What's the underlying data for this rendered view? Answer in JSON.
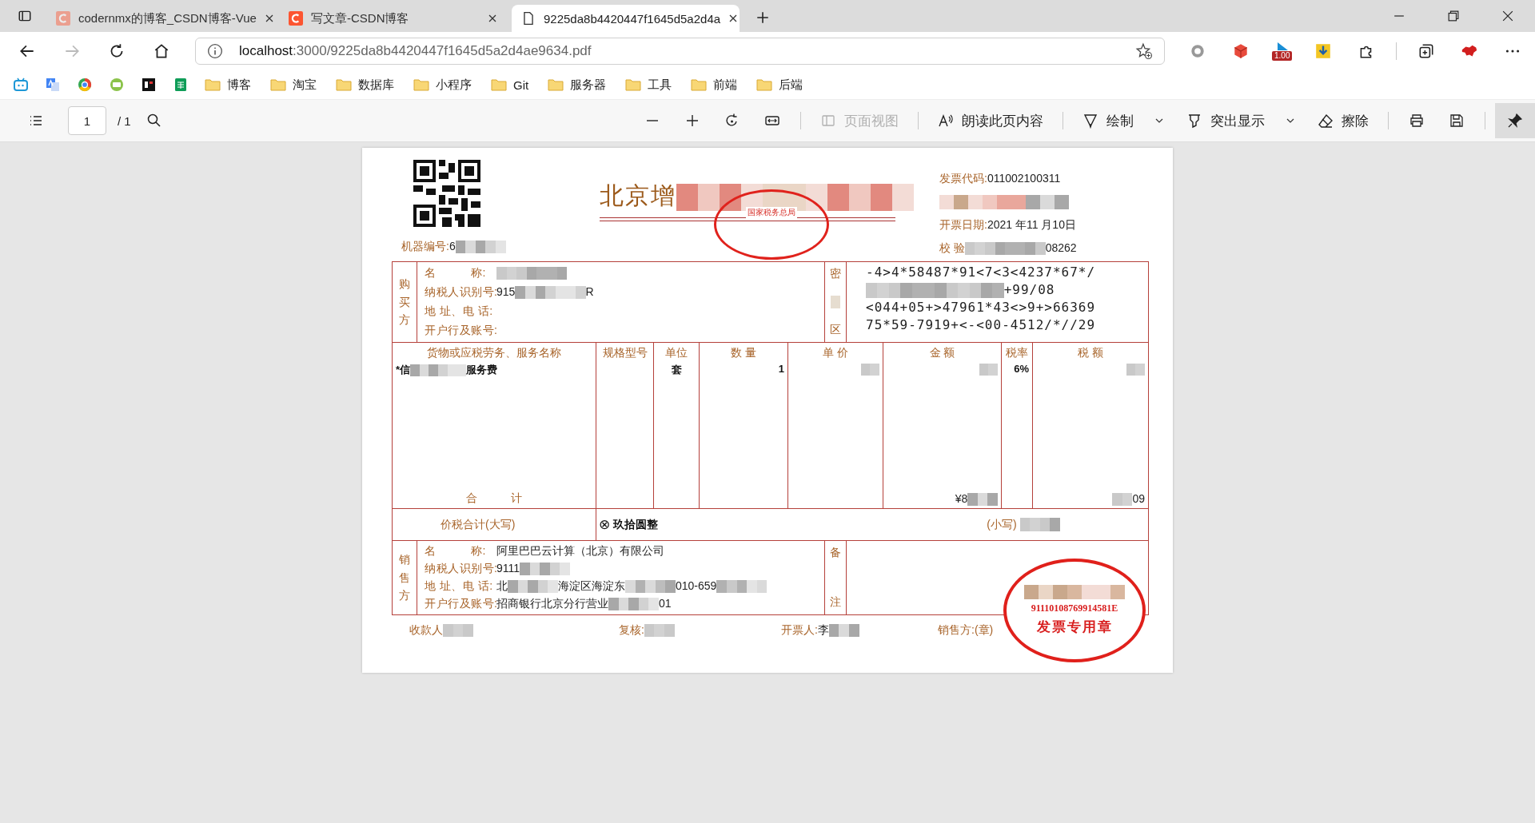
{
  "tabs": [
    {
      "title": "codernmx的博客_CSDN博客-Vue",
      "kind": "site",
      "selected": false
    },
    {
      "title": "写文章-CSDN博客",
      "kind": "site",
      "selected": false
    },
    {
      "title": "9225da8b4420447f1645d5a2d4a",
      "kind": "file",
      "selected": true
    }
  ],
  "address_bar": {
    "host": "localhost",
    "path": ":3000/9225da8b4420447f1645d5a2d4ae9634.pdf"
  },
  "extension_badge": "1.00",
  "bookmark_folders": [
    "博客",
    "淘宝",
    "数据库",
    "小程序",
    "Git",
    "服务器",
    "工具",
    "前端",
    "后端"
  ],
  "pdf_toolbar": {
    "page": "1",
    "page_total": "/ 1",
    "tools": [
      {
        "kind": "view",
        "label": "页面视图",
        "disabled": true
      },
      {
        "kind": "read",
        "label": "朗读此页内容",
        "disabled": false
      },
      {
        "kind": "draw",
        "label": "绘制",
        "disabled": false
      },
      {
        "kind": "highlight",
        "label": "突出显示",
        "disabled": false
      },
      {
        "kind": "erase",
        "label": "擦除",
        "disabled": false
      }
    ]
  },
  "invoice": {
    "title": [
      {
        "kind": "text",
        "text": "北京增"
      },
      {
        "kind": "redacted"
      }
    ],
    "stamp_text": "国家税务总局",
    "code": {
      "label": "发票代码:",
      "parts": [
        {
          "kind": "text",
          "text": "011002100311"
        }
      ]
    },
    "date": {
      "label": "开票日期:",
      "parts": [
        {
          "kind": "text",
          "text": "2021 年11 月10日"
        }
      ]
    },
    "check": {
      "label": "校 验",
      "parts": [
        {
          "kind": "redacted"
        },
        {
          "kind": "text",
          "text": "08262"
        }
      ]
    },
    "machine": {
      "label": "机器编号:",
      "parts": [
        {
          "kind": "text",
          "text": "6"
        },
        {
          "kind": "redacted"
        }
      ]
    },
    "buyer": {
      "side": "购买方",
      "fields": [
        {
          "label": "名　　　称:",
          "parts": [
            {
              "kind": "redacted"
            }
          ]
        },
        {
          "label": "纳税人识别号:",
          "parts": [
            {
              "kind": "text",
              "text": "915"
            },
            {
              "kind": "redacted"
            },
            {
              "kind": "text",
              "text": "R"
            }
          ]
        },
        {
          "label": "地 址、电 话:"
        },
        {
          "label": "开户行及账号:"
        }
      ]
    },
    "cipher_label": [
      "密",
      "区"
    ],
    "cipher_lines": [
      {
        "parts": [
          {
            "kind": "text",
            "text": "-4>4*58487*91<7<3<4237*67*/"
          }
        ]
      },
      {
        "parts": [
          {
            "kind": "redacted"
          },
          {
            "kind": "text",
            "text": "+99/08"
          }
        ]
      },
      {
        "parts": [
          {
            "kind": "text",
            "text": "<044+05+>47961*43<>9+>66369"
          }
        ]
      },
      {
        "parts": [
          {
            "kind": "text",
            "text": "75*59-7919+<-<00-4512/*//29"
          }
        ]
      }
    ],
    "columns": [
      {
        "header": "货物或应税劳务、服务名称",
        "value": [
          {
            "kind": "text",
            "text": "*信"
          },
          {
            "kind": "redacted"
          },
          {
            "kind": "text",
            "text": "服务费"
          }
        ]
      },
      {
        "header": "规格型号"
      },
      {
        "header": "单位",
        "value": [
          {
            "kind": "text",
            "text": "套"
          }
        ]
      },
      {
        "header": "数 量",
        "value": [
          {
            "kind": "text",
            "text": "1"
          }
        ]
      },
      {
        "header": "单 价",
        "value": [
          {
            "kind": "redacted"
          }
        ]
      },
      {
        "header": "金 额",
        "value": [
          {
            "kind": "redacted"
          }
        ]
      },
      {
        "header": "税率",
        "value": [
          {
            "kind": "text",
            "text": "6%"
          }
        ]
      },
      {
        "header": "税 额",
        "value": [
          {
            "kind": "redacted"
          }
        ]
      }
    ],
    "total": {
      "label": "合　　　计",
      "amount": [
        {
          "kind": "text",
          "text": "¥8"
        },
        {
          "kind": "redacted"
        }
      ],
      "tax": [
        {
          "kind": "redacted"
        },
        {
          "kind": "text",
          "text": "09"
        }
      ]
    },
    "total_in_words": {
      "label": "价税合计(大写)",
      "symbol": "⊗",
      "words": "玖拾圆整",
      "lower_label": "(小写)",
      "lower": [
        {
          "kind": "redacted"
        }
      ]
    },
    "seller": {
      "side": "销售方",
      "fields": [
        {
          "label": "名　　　称:",
          "parts": [
            {
              "kind": "text",
              "text": "阿里巴巴云计算（北京）有限公司"
            }
          ]
        },
        {
          "label": "纳税人识别号:",
          "parts": [
            {
              "kind": "text",
              "text": "9111"
            },
            {
              "kind": "redacted"
            }
          ]
        },
        {
          "label": "地 址、电 话:",
          "parts": [
            {
              "kind": "text",
              "text": "北"
            },
            {
              "kind": "redacted"
            },
            {
              "kind": "text",
              "text": "海淀区海淀东"
            },
            {
              "kind": "redacted"
            },
            {
              "kind": "text",
              "text": "010-659"
            },
            {
              "kind": "redacted"
            }
          ]
        },
        {
          "label": "开户行及账号:",
          "parts": [
            {
              "kind": "text",
              "text": "招商银行北京分行营业"
            },
            {
              "kind": "redacted"
            },
            {
              "kind": "text",
              "text": "01"
            }
          ]
        }
      ]
    },
    "remarks_label": [
      "备",
      "注"
    ],
    "seller_stamp": {
      "number": "91110108769914581E",
      "text": "发票专用章"
    },
    "signatures": [
      {
        "label": "收款人",
        "parts": [
          {
            "kind": "redacted"
          }
        ]
      },
      {
        "label": "复核:",
        "parts": [
          {
            "kind": "redacted"
          }
        ]
      },
      {
        "label": "开票人:",
        "parts": [
          {
            "kind": "text",
            "text": "李"
          },
          {
            "kind": "redacted"
          }
        ]
      },
      {
        "label": "销售方:(章)"
      }
    ]
  }
}
